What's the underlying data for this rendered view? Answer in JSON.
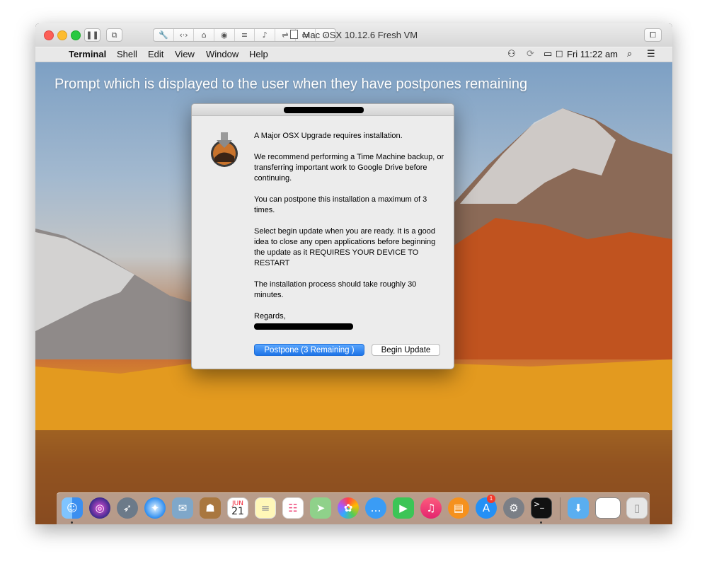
{
  "window": {
    "title": "Mac OSX 10.12.6 Fresh VM"
  },
  "menubar": {
    "app": "Terminal",
    "items": [
      "Shell",
      "Edit",
      "View",
      "Window",
      "Help"
    ],
    "clock": "Fri 11:22 am"
  },
  "overlay_caption": "Prompt which is displayed to the user when they have postpones remaining",
  "dialog": {
    "paragraphs": [
      "A Major OSX Upgrade requires installation.",
      "We recommend performing a Time Machine backup, or transferring important work to Google Drive before continuing.",
      "You can postpone this installation a maximum of 3 times.",
      "Select begin update when you are ready. It is a good idea to close any open applications before beginning the update as it REQUIRES YOUR DEVICE TO RESTART",
      "The installation process should take roughly 30 minutes."
    ],
    "regards": "Regards,",
    "postpone_label": "Postpone (3 Remaining )",
    "begin_label": "Begin Update"
  },
  "dock": {
    "calendar_month": "JUN",
    "calendar_day": "21",
    "app_store_badge": "1"
  }
}
